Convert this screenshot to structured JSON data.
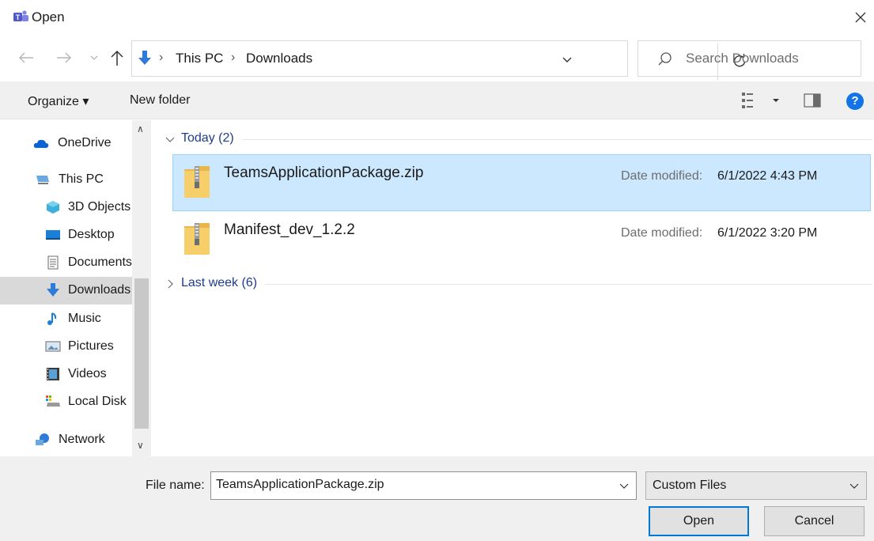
{
  "window": {
    "title": "Open"
  },
  "address": {
    "crumbs": [
      "This PC",
      "Downloads"
    ]
  },
  "search": {
    "placeholder": "Search Downloads"
  },
  "toolbar": {
    "organize_label": "Organize ▾",
    "new_folder_label": "New folder",
    "help_label": "?"
  },
  "sidebar": {
    "items": [
      {
        "label": "OneDrive",
        "icon": "onedrive-icon"
      },
      {
        "label": "This PC",
        "icon": "computer-icon"
      },
      {
        "label": "3D Objects",
        "icon": "3d-objects-icon"
      },
      {
        "label": "Desktop",
        "icon": "desktop-icon"
      },
      {
        "label": "Documents",
        "icon": "documents-icon"
      },
      {
        "label": "Downloads",
        "icon": "download-icon",
        "selected": true
      },
      {
        "label": "Music",
        "icon": "music-icon"
      },
      {
        "label": "Pictures",
        "icon": "pictures-icon"
      },
      {
        "label": "Videos",
        "icon": "videos-icon"
      },
      {
        "label": "Local Disk",
        "icon": "local-disk-icon"
      },
      {
        "label": "Network",
        "icon": "network-icon"
      }
    ]
  },
  "groups": [
    {
      "label": "Today (2)",
      "expanded": true,
      "files": [
        {
          "name": "TeamsApplicationPackage.zip",
          "date_label": "Date modified:",
          "date": "6/1/2022 4:43 PM",
          "selected": true
        },
        {
          "name": "Manifest_dev_1.2.2",
          "date_label": "Date modified:",
          "date": "6/1/2022 3:20 PM",
          "selected": false
        }
      ]
    },
    {
      "label": "Last week (6)",
      "expanded": false,
      "files": []
    }
  ],
  "bottom": {
    "file_name_label": "File name:",
    "file_name_value": "TeamsApplicationPackage.zip",
    "file_type": "Custom Files",
    "open_label": "Open",
    "cancel_label": "Cancel"
  },
  "colors": {
    "accent": "#0078d7",
    "selection": "#cce8ff",
    "group_header": "#1e3c8c"
  }
}
